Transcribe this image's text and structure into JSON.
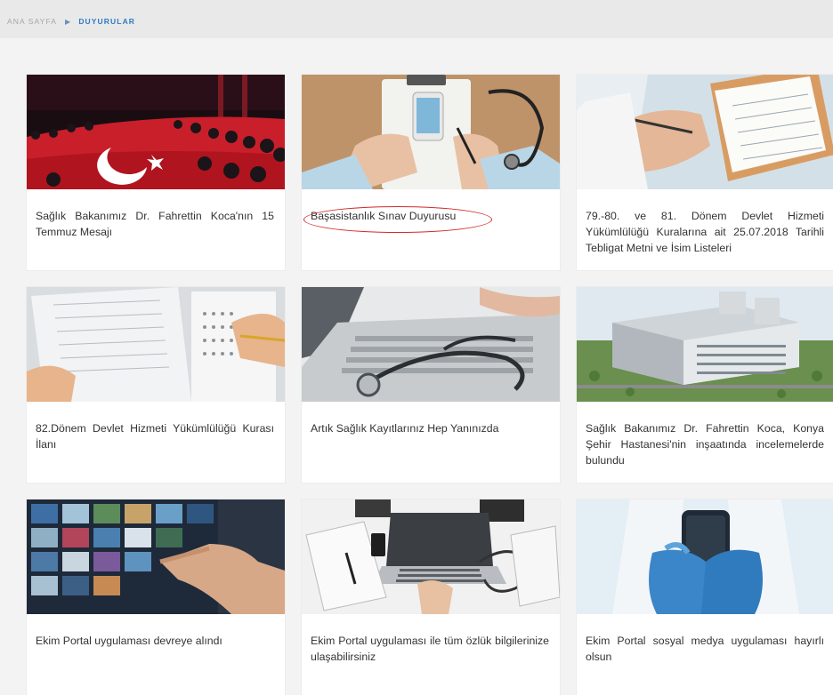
{
  "breadcrumb": {
    "home": "ANA SAYFA",
    "separator": "▶",
    "current": "DUYURULAR"
  },
  "colors": {
    "accent": "#2e7bc3",
    "highlight": "#d12b2b"
  },
  "cards": [
    {
      "title": "Sağlık Bakanımız Dr. Fahrettin Koca'nın 15 Temmuz Mesajı",
      "image": "crowd-with-turkish-flag-photo"
    },
    {
      "title": "Başasistanlık Sınav Duyurusu",
      "image": "doctor-desk-with-phone-photo"
    },
    {
      "title": "79.-80. ve 81. Dönem Devlet Hizmeti Yükümlülüğü Kuralarına ait 25.07.2018 Tarihli Tebligat Metni ve İsim Listeleri",
      "image": "doctor-writing-on-clipboard-photo"
    },
    {
      "title": "82.Dönem Devlet Hizmeti Yükümlülüğü Kurası İlanı",
      "image": "exam-answer-sheet-photo"
    },
    {
      "title": "Artık Sağlık Kayıtlarınız Hep Yanınızda",
      "image": "stethoscope-on-laptop-photo"
    },
    {
      "title": "Sağlık Bakanımız Dr. Fahrettin Koca, Konya Şehir Hastanesi'nin inşaatında incelemelerde bulundu",
      "image": "city-hospital-rendering-photo"
    },
    {
      "title": "Ekim Portal uygulaması devreye alındı",
      "image": "hand-touching-media-wall-photo"
    },
    {
      "title": "Ekim Portal uygulaması ile tüm özlük bilgilerinize ulaşabilirsiniz",
      "image": "laptop-on-desk-overhead-photo"
    },
    {
      "title": "Ekim Portal sosyal medya uygulaması hayırlı olsun",
      "image": "doctor-holding-smartphone-photo"
    }
  ]
}
